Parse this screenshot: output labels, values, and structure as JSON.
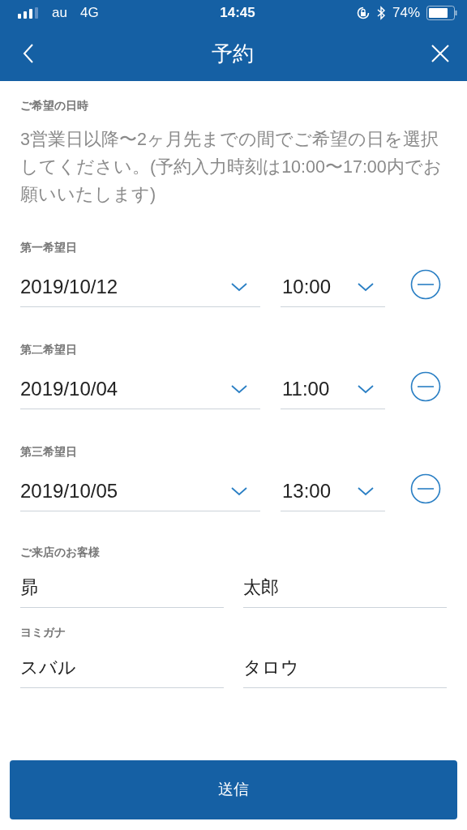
{
  "status_bar": {
    "carrier": "au",
    "network": "4G",
    "time": "14:45",
    "battery": "74%"
  },
  "nav": {
    "title": "予約"
  },
  "intro": {
    "label": "ご希望の日時",
    "description": "3営業日以降〜2ヶ月先までの間でご希望の日を選択してください。(予約入力時刻は10:00〜17:00内でお願いいたします)"
  },
  "preferred_dates": [
    {
      "label": "第一希望日",
      "date": "2019/10/12",
      "time": "10:00"
    },
    {
      "label": "第二希望日",
      "date": "2019/10/04",
      "time": "11:00"
    },
    {
      "label": "第三希望日",
      "date": "2019/10/05",
      "time": "13:00"
    }
  ],
  "name_fields": [
    {
      "label": "ご来店のお客様",
      "last": "昴",
      "first": "太郎"
    },
    {
      "label": "ヨミガナ",
      "last": "スバル",
      "first": "タロウ"
    }
  ],
  "submit": "送信"
}
